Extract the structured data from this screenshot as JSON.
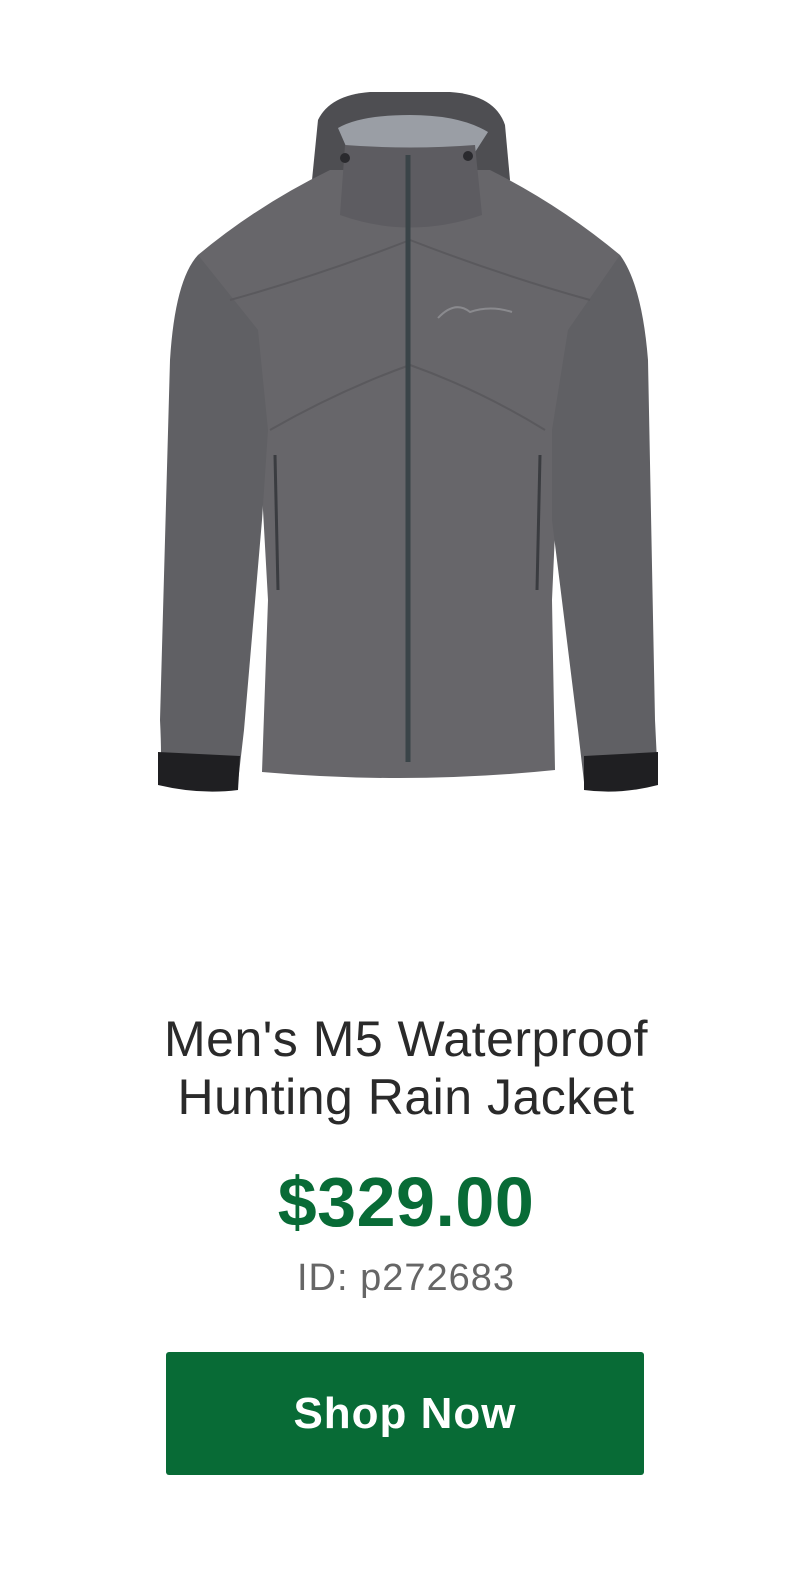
{
  "product": {
    "image_icon": "rain-jacket-image",
    "title_line1": "Men's M5 Waterproof",
    "title_line2": "Hunting Rain Jacket",
    "price": "$329.00",
    "id_text": "ID: p272683"
  },
  "cta": {
    "label": "Shop Now"
  },
  "colors": {
    "brand_green": "#086b36",
    "jacket_gray": "#67666a"
  }
}
